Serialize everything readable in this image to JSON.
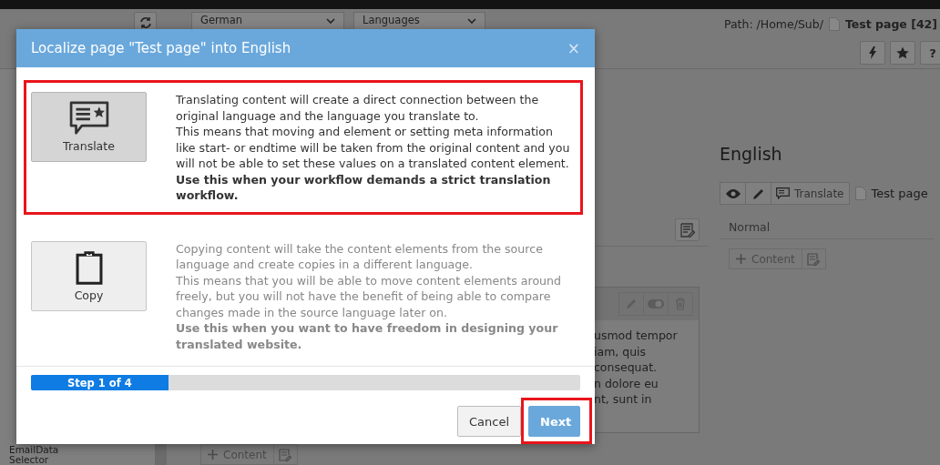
{
  "docheader": {
    "language_select": "German",
    "module_select": "Languages",
    "path_label": "Path: /Home/Sub/",
    "page_title": "Test page [42]",
    "buttons": [
      {
        "kind": "bolt"
      },
      {
        "kind": "star"
      },
      {
        "kind": "help",
        "label": "?"
      }
    ]
  },
  "sidebar": {
    "items": [
      "EmailData",
      "Selector"
    ]
  },
  "source_column": {
    "element_lines": [
      "usmod tempor",
      "iam, quis",
      "consequat.",
      "n dolore eu",
      "nt, sunt in"
    ],
    "add_button": "Content"
  },
  "target_column": {
    "language": "English",
    "translate_button": "Translate",
    "page_title": "Test page",
    "colpos": "Normal",
    "add_button": "Content"
  },
  "modal": {
    "title": "Localize page \"Test page\" into English",
    "close": "×",
    "options": [
      {
        "kind": "translate",
        "label": "Translate",
        "selected": true,
        "highlighted": true,
        "description": [
          "Translating content will create a direct connection between the original language and the language you translate to.",
          "This means that moving and element or setting meta information like start- or endtime will be taken from the original content and you will not be able to set these values on a translated content element."
        ],
        "emphasis": "Use this when your workflow demands a strict translation workflow."
      },
      {
        "kind": "copy",
        "label": "Copy",
        "selected": false,
        "highlighted": false,
        "description": [
          "Copying content will take the content elements from the source language and create copies in a different language.",
          "This means that you will be able to move content elements around freely, but you will not have the benefit of being able to compare changes made in the source language later on."
        ],
        "emphasis": "Use this when you want to have freedom in designing your translated website."
      }
    ],
    "progress": {
      "label": "Step 1 of 4",
      "level": 0.25
    },
    "buttons": [
      {
        "label": "Cancel",
        "kind": "default",
        "highlighted": false
      },
      {
        "label": "Next",
        "kind": "primary",
        "highlighted": true
      }
    ]
  }
}
